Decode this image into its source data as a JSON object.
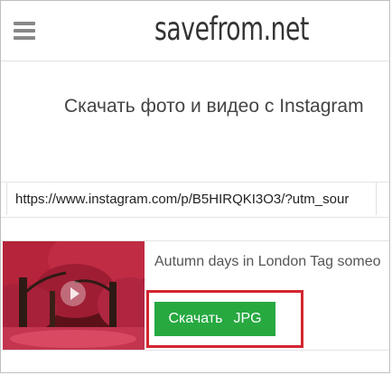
{
  "header": {
    "logo_text": "savefrom.net",
    "menu_icon": "hamburger-menu-icon"
  },
  "main": {
    "page_title": "Скачать фото и видео с Instagram",
    "url_input": {
      "value": "https://www.instagram.com/p/B5HIRQKI3O3/?utm_sour"
    }
  },
  "result": {
    "title": "Autumn days in London Tag someo",
    "thumbnail_icon": "play-icon",
    "download_button": {
      "label": "Скачать",
      "format": "JPG"
    }
  },
  "colors": {
    "button": "#27a940",
    "highlight": "#d32530",
    "thumbnail": "#8b1a2b"
  }
}
